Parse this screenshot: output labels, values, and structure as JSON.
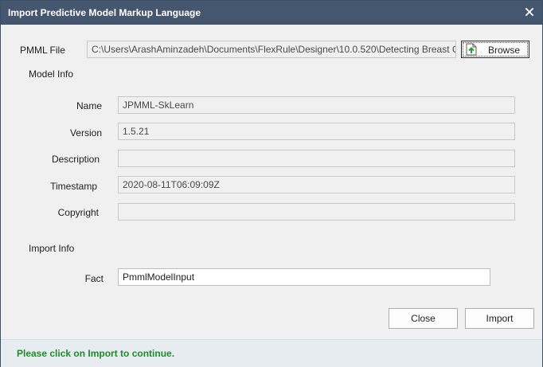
{
  "window": {
    "title": "Import Predictive Model Markup Language",
    "accent_color": "#44576e"
  },
  "pmml_file": {
    "label": "PMML File",
    "path": "C:\\Users\\ArashAminzadeh\\Documents\\FlexRule\\Designer\\10.0.520\\Detecting Breast C",
    "browse_label": "Browse"
  },
  "model_info": {
    "heading": "Model Info",
    "name_label": "Name",
    "name_value": "JPMML-SkLearn",
    "version_label": "Version",
    "version_value": "1.5.21",
    "description_label": "Description",
    "description_value": "",
    "timestamp_label": "Timestamp",
    "timestamp_value": "2020-08-11T06:09:09Z",
    "copyright_label": "Copyright",
    "copyright_value": ""
  },
  "import_info": {
    "heading": "Import Info",
    "fact_label": "Fact",
    "fact_value": "PmmlModelInput"
  },
  "buttons": {
    "close": "Close",
    "import": "Import"
  },
  "status": {
    "message": "Please click on Import to continue.",
    "color": "#1f8a2a"
  }
}
